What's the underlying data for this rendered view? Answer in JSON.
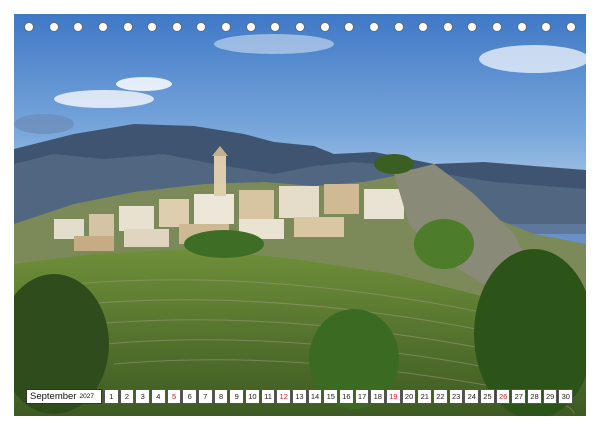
{
  "calendar": {
    "month": "September",
    "year": "2027",
    "days": [
      {
        "n": "1",
        "sun": false
      },
      {
        "n": "2",
        "sun": false
      },
      {
        "n": "3",
        "sun": false
      },
      {
        "n": "4",
        "sun": false
      },
      {
        "n": "5",
        "sun": true
      },
      {
        "n": "6",
        "sun": false
      },
      {
        "n": "7",
        "sun": false
      },
      {
        "n": "8",
        "sun": false
      },
      {
        "n": "9",
        "sun": false
      },
      {
        "n": "10",
        "sun": false
      },
      {
        "n": "11",
        "sun": false
      },
      {
        "n": "12",
        "sun": true
      },
      {
        "n": "13",
        "sun": false
      },
      {
        "n": "14",
        "sun": false
      },
      {
        "n": "15",
        "sun": false
      },
      {
        "n": "16",
        "sun": false
      },
      {
        "n": "17",
        "sun": false
      },
      {
        "n": "18",
        "sun": false
      },
      {
        "n": "19",
        "sun": true
      },
      {
        "n": "20",
        "sun": false
      },
      {
        "n": "21",
        "sun": false
      },
      {
        "n": "22",
        "sun": false
      },
      {
        "n": "23",
        "sun": false
      },
      {
        "n": "24",
        "sun": false
      },
      {
        "n": "25",
        "sun": false
      },
      {
        "n": "26",
        "sun": true
      },
      {
        "n": "27",
        "sun": false
      },
      {
        "n": "28",
        "sun": false
      },
      {
        "n": "29",
        "sun": false
      },
      {
        "n": "30",
        "sun": false
      }
    ]
  },
  "binding": {
    "ring_count": 23
  },
  "colors": {
    "sunday": "#d0212a",
    "sky": "#4f86c9",
    "foliage": "#4e7a2c"
  }
}
